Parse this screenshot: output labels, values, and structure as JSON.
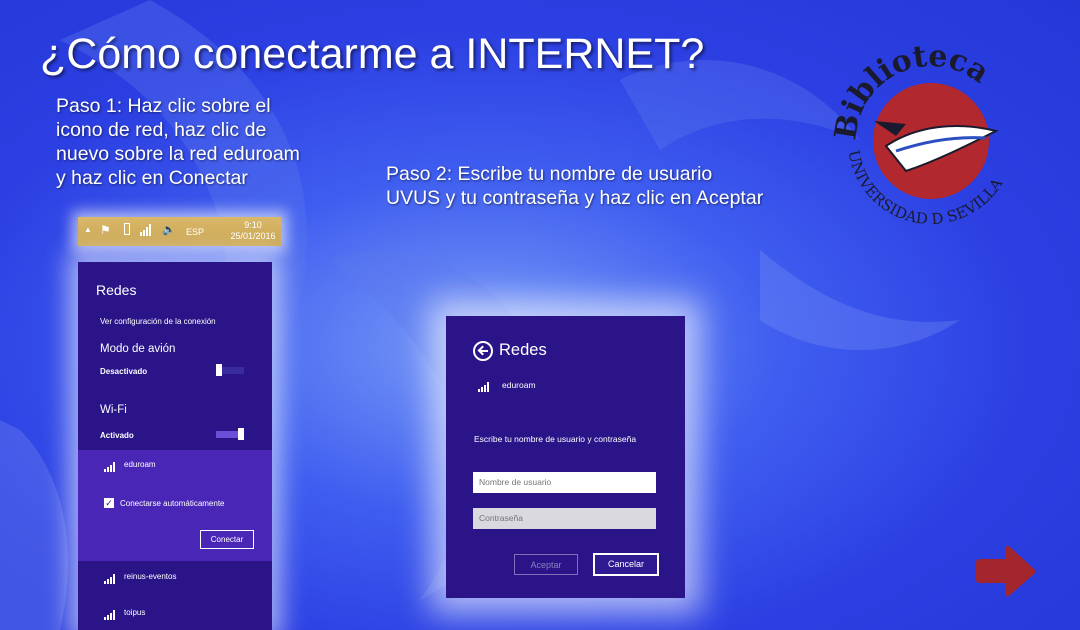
{
  "title": "¿Cómo conectarme a INTERNET?",
  "step1": {
    "lines": [
      "Paso 1: Haz clic sobre el",
      "icono de red,  haz clic de",
      "nuevo sobre la red eduroam",
      "y haz clic en Conectar"
    ]
  },
  "step2": {
    "lines": [
      "Paso 2: Escribe tu nombre de usuario",
      "UVUS y tu contraseña y haz clic en Aceptar"
    ]
  },
  "logo": {
    "top_text": "Biblioteca",
    "bottom_text": "UNIVERSIDAD D SEVILLA",
    "color": "#b1282e"
  },
  "taskbar": {
    "language": "ESP",
    "time": "9:10",
    "date": "25/01/2016",
    "icons": [
      "chevron-up-icon",
      "flag-icon",
      "battery-icon",
      "network-icon",
      "volume-icon"
    ]
  },
  "networks_panel": {
    "header": "Redes",
    "settings_link": "Ver configuración de la conexión",
    "airplane_label": "Modo de avión",
    "airplane_state": "Desactivado",
    "airplane_on": false,
    "wifi_label": "Wi-Fi",
    "wifi_state": "Activado",
    "wifi_on": true,
    "selected_network": "eduroam",
    "auto_connect_label": "Conectarse automáticamente",
    "auto_connect_checked": true,
    "connect_button": "Conectar",
    "other_networks": [
      "reinus-eventos",
      "toipus"
    ]
  },
  "login_panel": {
    "header": "Redes",
    "network": "eduroam",
    "prompt": "Escribe tu nombre de usuario y contraseña",
    "username_placeholder": "Nombre de usuario",
    "password_placeholder": "Contraseña",
    "accept_button": "Aceptar",
    "cancel_button": "Cancelar"
  },
  "colors": {
    "panel_bg": "#2a1488",
    "selected_bg": "#4a26b6",
    "arrow": "#a3262c",
    "taskbar": "#d4b060"
  }
}
